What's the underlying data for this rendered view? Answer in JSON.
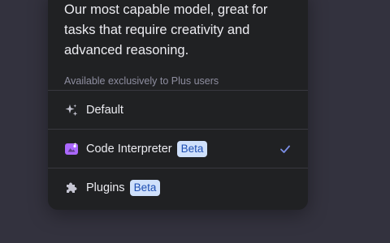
{
  "model_menu": {
    "description": "Our most capable model, great for tasks that require creativity and advanced reasoning.",
    "availability_note": "Available exclusively to Plus users",
    "options": [
      {
        "label": "Default",
        "icon": "sparkle-icon",
        "badge": null,
        "selected": false
      },
      {
        "label": "Code Interpreter",
        "icon": "code-interpreter-icon",
        "badge": "Beta",
        "selected": true
      },
      {
        "label": "Plugins",
        "icon": "puzzle-piece-icon",
        "badge": "Beta",
        "selected": false
      }
    ]
  },
  "colors": {
    "page_background": "#33323e",
    "panel_background": "#202123",
    "text_primary": "#ececf1",
    "text_secondary": "#8e8ea0",
    "badge_background": "#cfe0fb",
    "badge_text": "#1f4fb3",
    "checkmark": "#7b8fe6",
    "code_interpreter_icon": "#ab68ff"
  }
}
